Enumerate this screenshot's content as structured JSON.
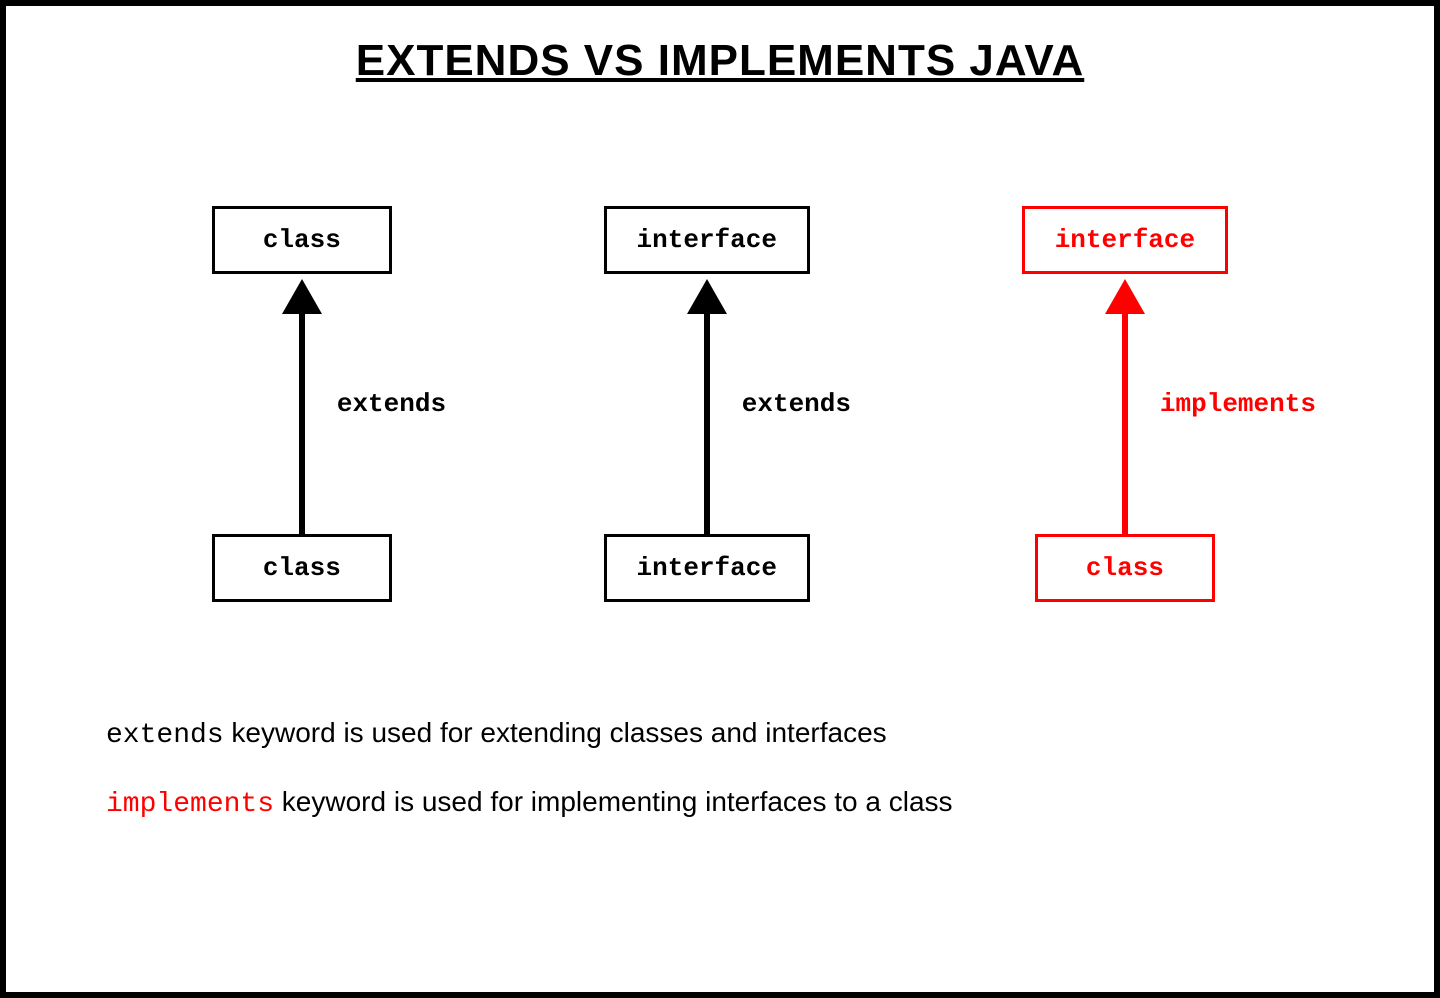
{
  "title": "EXTENDS VS IMPLEMENTS JAVA",
  "columns": [
    {
      "top": "class",
      "bottom": "class",
      "label": "extends",
      "color": "black"
    },
    {
      "top": "interface",
      "bottom": "interface",
      "label": "extends",
      "color": "black"
    },
    {
      "top": "interface",
      "bottom": "class",
      "label": "implements",
      "color": "red"
    }
  ],
  "notes": {
    "line1": {
      "keyword": "extends",
      "rest": " keyword is used for extending classes and interfaces"
    },
    "line2": {
      "keyword": "implements",
      "rest": " keyword is used for implementing interfaces to a class"
    }
  }
}
